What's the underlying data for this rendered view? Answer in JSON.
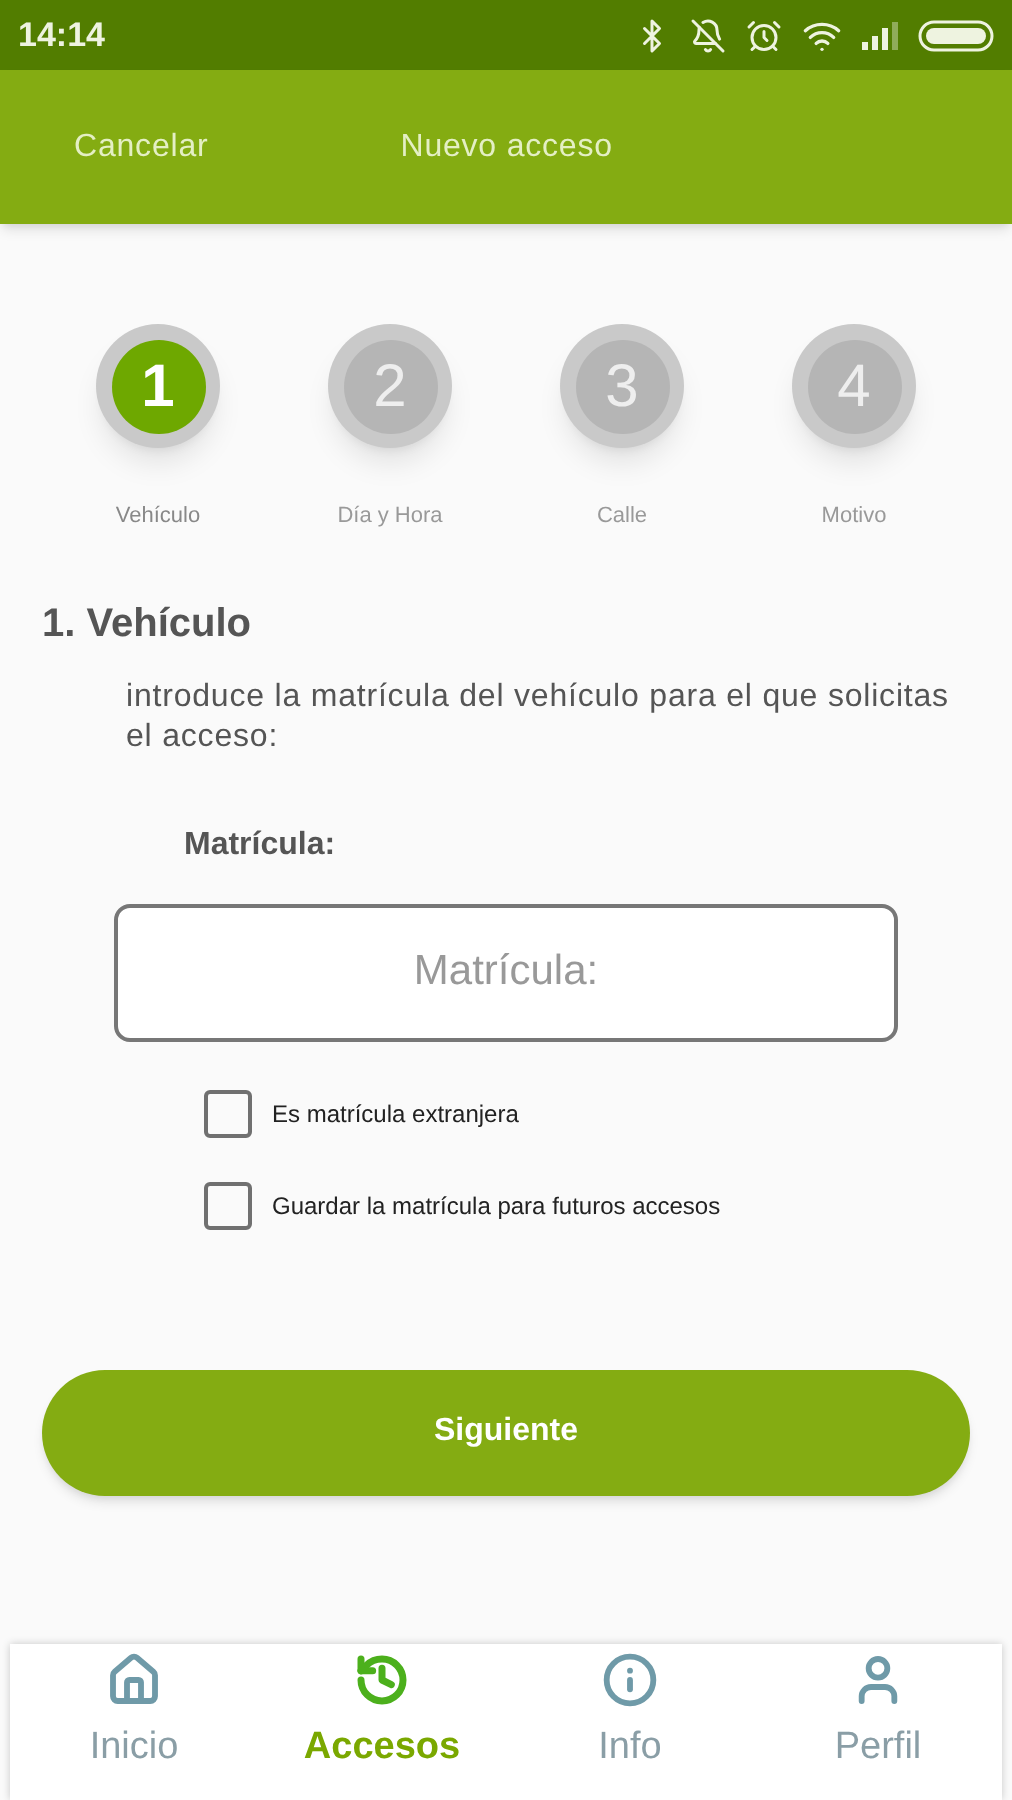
{
  "status_bar": {
    "time": "14:14"
  },
  "header": {
    "cancel": "Cancelar",
    "title": "Nuevo acceso"
  },
  "steps": [
    {
      "number": "1",
      "label": "Vehículo",
      "selected": true
    },
    {
      "number": "2",
      "label": "Día y Hora",
      "selected": false
    },
    {
      "number": "3",
      "label": "Calle",
      "selected": false
    },
    {
      "number": "4",
      "label": "Motivo",
      "selected": false
    }
  ],
  "section": {
    "title": "1. Vehículo",
    "description": "introduce la matrícula del vehículo para el que solicitas el acceso:",
    "field_label": "Matrícula:",
    "placeholder": "Matrícula:"
  },
  "options": [
    {
      "label": "Es matrícula extranjera",
      "checked": false
    },
    {
      "label": "Guardar la matrícula para futuros accesos",
      "checked": false
    }
  ],
  "next_button": "Siguiente",
  "nav": [
    {
      "label": "Inicio",
      "kind": "home",
      "selected": false
    },
    {
      "label": "Accesos",
      "kind": "history",
      "selected": true
    },
    {
      "label": "Info",
      "kind": "info",
      "selected": false
    },
    {
      "label": "Perfil",
      "kind": "user",
      "selected": false
    }
  ]
}
